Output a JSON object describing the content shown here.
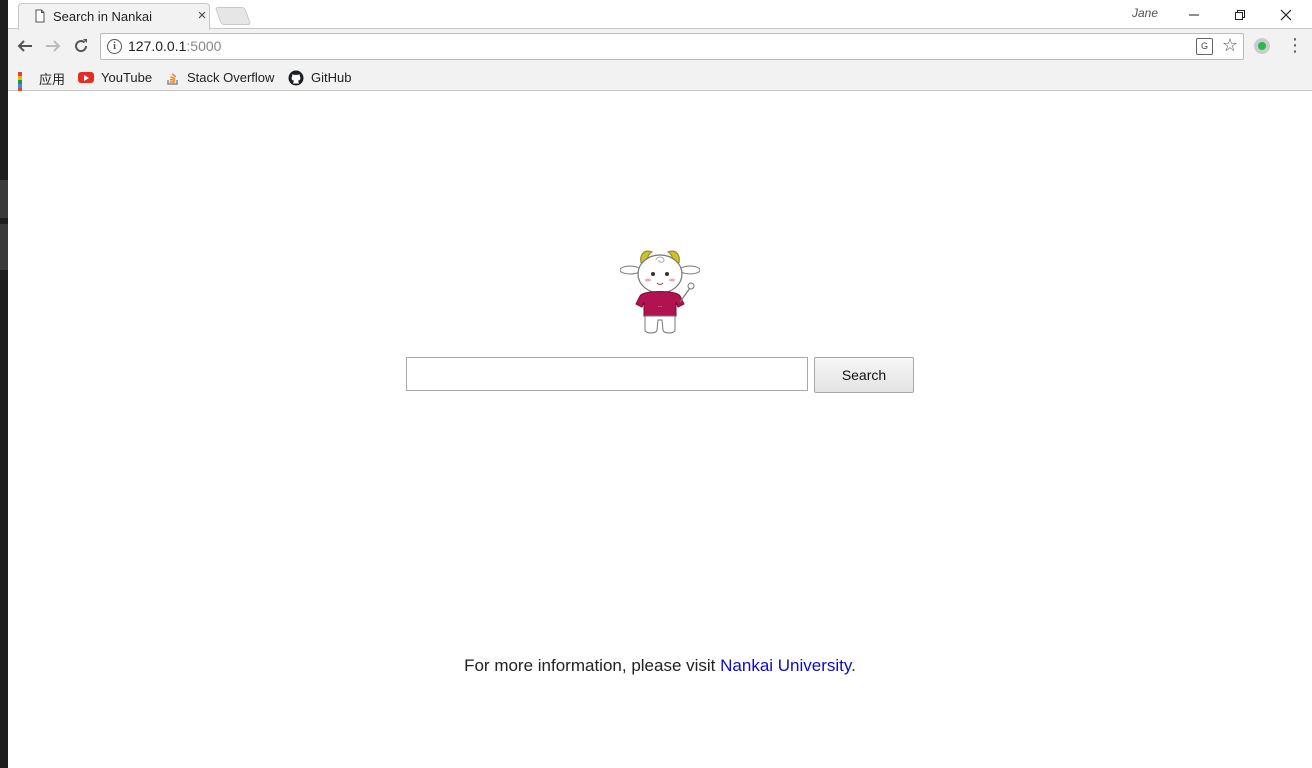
{
  "browser": {
    "tab_title": "Search in Nankai",
    "close_tab": "×",
    "profile_name": "Jane",
    "window_controls": {
      "minimize": "—",
      "restore": "❐",
      "close": "✕"
    },
    "address": {
      "host": "127.0.0.1",
      "port": ":5000"
    },
    "translate_glyph": "G",
    "star_glyph": "☆",
    "nav": {
      "back": "←",
      "forward": "→",
      "reload": "↻",
      "menu": "⋮"
    }
  },
  "bookmarks": [
    {
      "label": "应用",
      "icon": "apps-grid-icon"
    },
    {
      "label": "YouTube",
      "icon": "youtube-icon"
    },
    {
      "label": "Stack Overflow",
      "icon": "stackoverflow-icon"
    },
    {
      "label": "GitHub",
      "icon": "github-icon"
    }
  ],
  "page": {
    "search_input_value": "",
    "search_button": "Search",
    "footer_prefix": "For more information, please visit ",
    "footer_link": "Nankai University",
    "footer_suffix": "."
  },
  "colors": {
    "link": "#0c0ccc",
    "mascot_shirt": "#b0134f",
    "mascot_horn": "#c9c22a",
    "youtube_red": "#e52d27",
    "extension_green": "#2db84d"
  }
}
